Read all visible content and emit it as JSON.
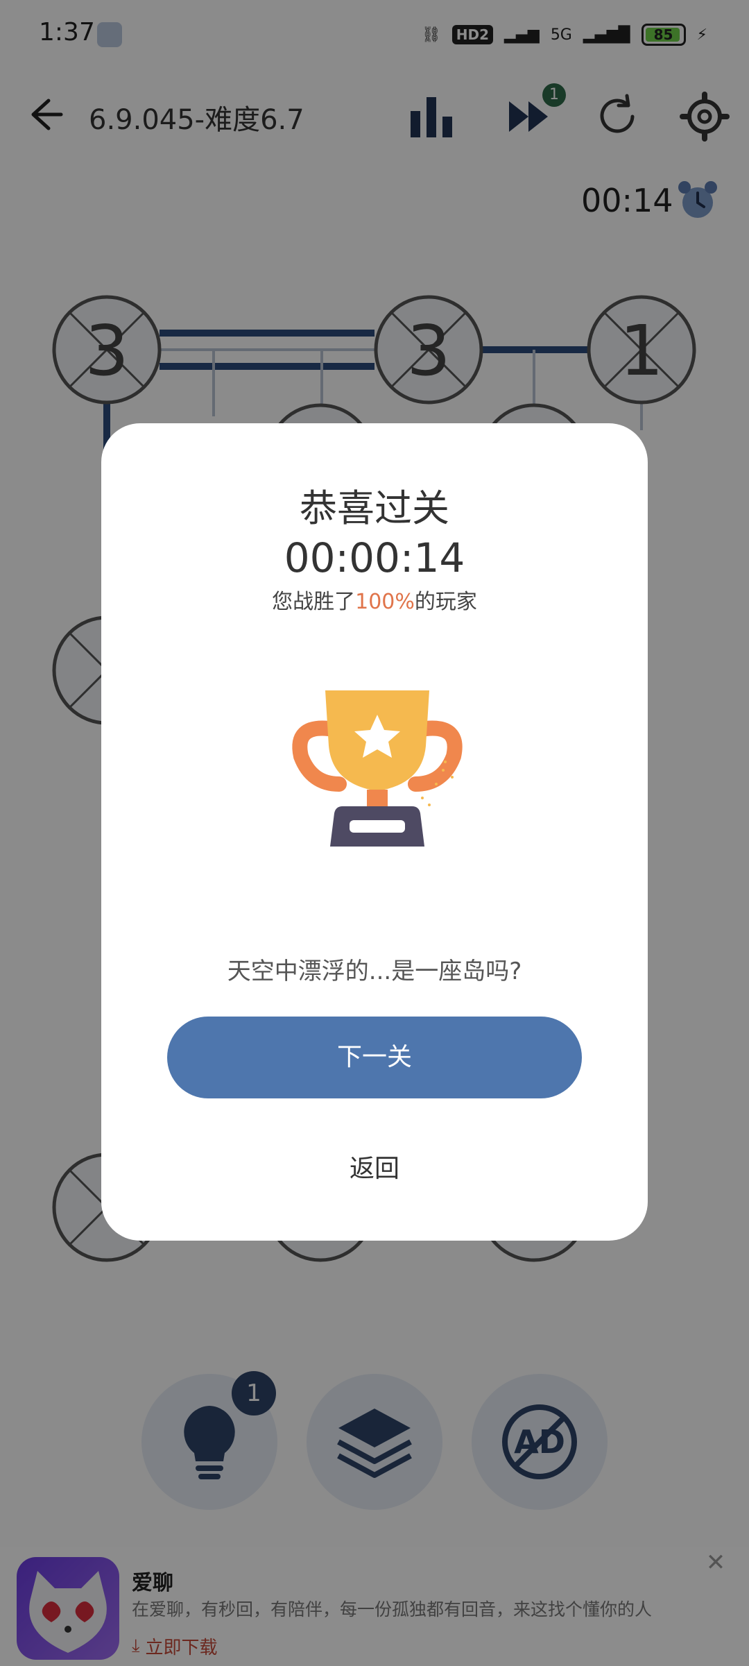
{
  "status_bar": {
    "time": "1:37",
    "network_hd": "HD2",
    "network_5g": "5G",
    "battery": "85"
  },
  "top_bar": {
    "level_title": "6.9.045-难度6.7",
    "skip_count": "1"
  },
  "timer": "00:14",
  "board": {
    "nodes": [
      {
        "label": "3",
        "row": 0,
        "col": 0
      },
      {
        "label": "3",
        "row": 0,
        "col": 2
      },
      {
        "label": "1",
        "row": 0,
        "col": 3
      }
    ]
  },
  "tools": {
    "hint_count": "1",
    "icons": [
      "lightbulb-icon",
      "layers-icon",
      "no-ad-icon"
    ]
  },
  "ad": {
    "title": "爱聊",
    "description": "在爱聊，有秒回，有陪伴，每一份孤独都有回音，来这找个懂你的人",
    "download_label": "立即下载"
  },
  "dialog": {
    "title": "恭喜过关",
    "time": "00:00:14",
    "beat_prefix": "您战胜了",
    "beat_percent": "100%",
    "beat_suffix": "的玩家",
    "tip": "天空中漂浮的...是一座岛吗?",
    "next_label": "下一关",
    "return_label": "返回"
  },
  "colors": {
    "accent_blue": "#4e76ad",
    "percent_orange": "#e0744a",
    "trophy_orange": "#f0874d",
    "trophy_gold": "#f5b94f",
    "trophy_base": "#4e4a63"
  }
}
